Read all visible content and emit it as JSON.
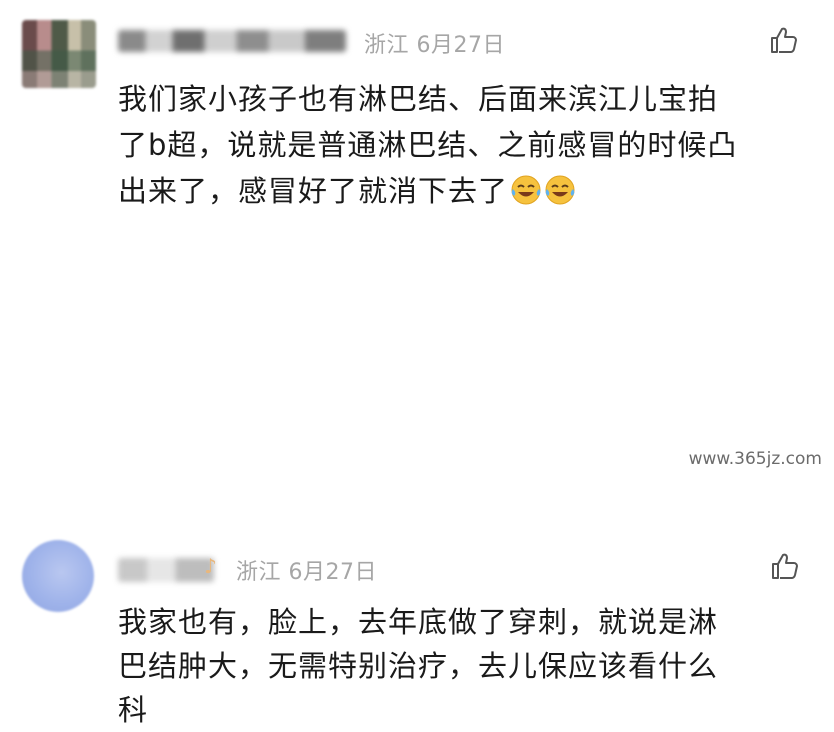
{
  "comments": [
    {
      "location": "浙江",
      "date": "6月27日",
      "lines": [
        "我们家小孩子也有淋巴结、后面来滨江儿宝拍",
        "了b超，说就是普通淋巴结、之前感冒的时候凸",
        "出来了，感冒好了就消下去了"
      ],
      "emojis": [
        "laughing-crying-emoji",
        "laughing-crying-emoji"
      ],
      "like_icon": "thumbs-up-outline-icon"
    },
    {
      "location": "浙江",
      "date": "6月27日",
      "lines": [
        "我家也有，脸上，去年底做了穿刺，就说是淋",
        "巴结肿大，无需特别治疗，去儿保应该看什么",
        "科"
      ],
      "like_icon": "thumbs-up-outline-icon"
    }
  ],
  "watermark": "www.365jz.com",
  "colors": {
    "meta": "#a6a6a6",
    "text": "#1a1a1a",
    "avatar2": "#a9bbee"
  }
}
